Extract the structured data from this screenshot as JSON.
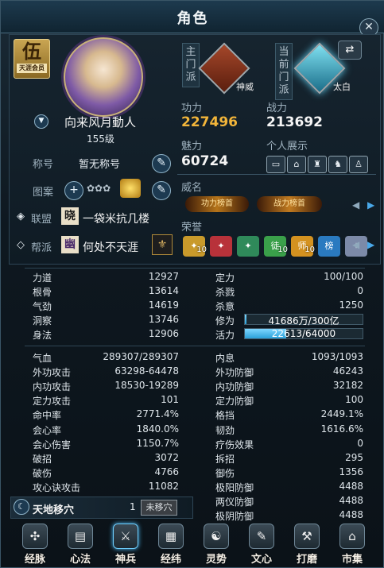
{
  "window": {
    "title": "角色"
  },
  "profile": {
    "rank_char": "伍",
    "rank_sub": "天涯会员",
    "name": "向来风月動人",
    "level": "155级",
    "title_label": "称号",
    "title_value": "暂无称号",
    "pattern_label": "图案",
    "alliance_label": "联盟",
    "alliance_char": "晓",
    "alliance_name": "一袋米抗几楼",
    "sect_label": "帮派",
    "sect_char": "幽",
    "sect_name": "何处不天涯"
  },
  "sects": {
    "main_label": "主门派",
    "main_name": "神威",
    "current_label": "当前门派",
    "current_name": "太白"
  },
  "combat": {
    "gongli_label": "功力",
    "gongli_value": "227496",
    "zhanli_label": "战力",
    "zhanli_value": "213692",
    "meili_label": "魅力",
    "meili_value": "60724",
    "display_label": "个人展示",
    "weiming_label": "威名",
    "weiming_badges": [
      "功力榜首",
      "战力榜首"
    ],
    "honor_label": "荣誉",
    "honors": [
      {
        "icon": "wings-icon",
        "count": "10",
        "color": "#c99a2b"
      },
      {
        "icon": "helmet-icon",
        "count": "",
        "color": "#b8323a"
      },
      {
        "icon": "shield-icon",
        "count": "",
        "color": "#2f8a5a"
      },
      {
        "icon": "tu-icon",
        "count": "10",
        "color": "#3aa04a",
        "glyph": "徒"
      },
      {
        "icon": "shi-icon",
        "count": "10",
        "color": "#d49220",
        "glyph": "师"
      },
      {
        "icon": "bang-icon",
        "count": "",
        "color": "#2a7ac0",
        "glyph": "榜"
      },
      {
        "icon": "orb-icon",
        "count": "",
        "color": "#7c8aa8"
      }
    ]
  },
  "stats_left_1": [
    {
      "k": "力道",
      "v": "12927"
    },
    {
      "k": "根骨",
      "v": "13614"
    },
    {
      "k": "气劲",
      "v": "14619"
    },
    {
      "k": "洞察",
      "v": "13746"
    },
    {
      "k": "身法",
      "v": "12906"
    }
  ],
  "stats_right_1": [
    {
      "k": "定力",
      "v": "100/100"
    },
    {
      "k": "杀戮",
      "v": "0"
    },
    {
      "k": "杀意",
      "v": "1250"
    }
  ],
  "xiuwei": {
    "label": "修为",
    "text": "41686万/300亿",
    "fraction": 0.014
  },
  "huoli": {
    "label": "活力",
    "text": "22613/64000",
    "fraction": 0.353
  },
  "stats_left_2": [
    {
      "k": "气血",
      "v": "289307/289307"
    },
    {
      "k": "外功攻击",
      "v": "63298-64478"
    },
    {
      "k": "内功攻击",
      "v": "18530-19289"
    },
    {
      "k": "定力攻击",
      "v": "101"
    },
    {
      "k": "命中率",
      "v": "2771.4%"
    },
    {
      "k": "会心率",
      "v": "1840.0%"
    },
    {
      "k": "会心伤害",
      "v": "1150.7%"
    },
    {
      "k": "破招",
      "v": "3072"
    },
    {
      "k": "破伤",
      "v": "4766"
    },
    {
      "k": "攻心诀攻击",
      "v": "11082"
    }
  ],
  "stats_right_2": [
    {
      "k": "内息",
      "v": "1093/1093"
    },
    {
      "k": "外功防御",
      "v": "46243"
    },
    {
      "k": "内功防御",
      "v": "32182"
    },
    {
      "k": "定力防御",
      "v": "100"
    },
    {
      "k": "格挡",
      "v": "2449.1%"
    },
    {
      "k": "韧劲",
      "v": "1616.6%"
    },
    {
      "k": "疗伤效果",
      "v": "0"
    },
    {
      "k": "拆招",
      "v": "295"
    },
    {
      "k": "御伤",
      "v": "1356"
    },
    {
      "k": "极阳防御",
      "v": "4488"
    },
    {
      "k": "两仪防御",
      "v": "4488"
    },
    {
      "k": "极阴防御",
      "v": "4488"
    }
  ],
  "tiandi": {
    "label": "天地移穴",
    "count": "1",
    "status": "未移穴"
  },
  "nav": [
    {
      "label": "经脉",
      "icon": "meridian-icon",
      "glyph": "✣"
    },
    {
      "label": "心法",
      "icon": "book-icon",
      "glyph": "▤"
    },
    {
      "label": "神兵",
      "icon": "weapon-icon",
      "glyph": "⚔"
    },
    {
      "label": "经纬",
      "icon": "grid-icon",
      "glyph": "▦"
    },
    {
      "label": "灵势",
      "icon": "swirl-icon",
      "glyph": "☯"
    },
    {
      "label": "文心",
      "icon": "brush-icon",
      "glyph": "✎"
    },
    {
      "label": "打磨",
      "icon": "hammer-icon",
      "glyph": "⚒"
    },
    {
      "label": "市集",
      "icon": "market-icon",
      "glyph": "⌂"
    }
  ]
}
